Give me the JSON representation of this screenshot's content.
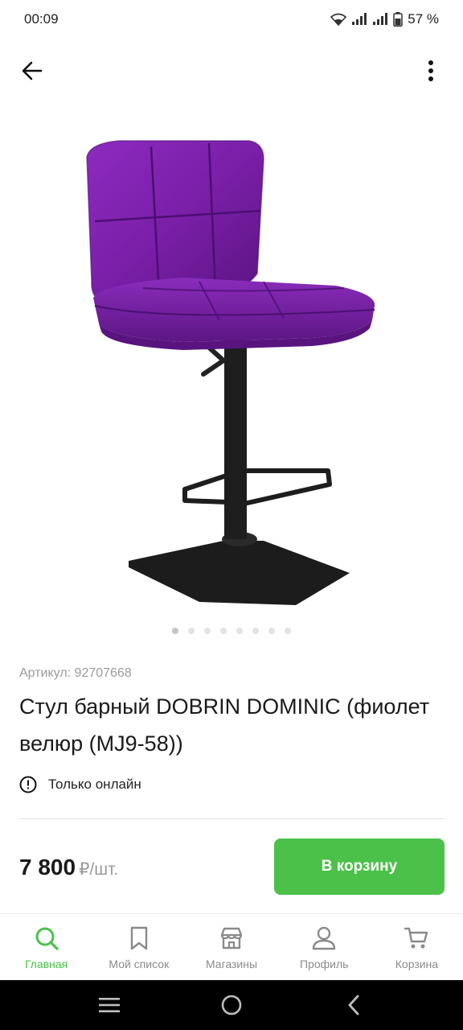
{
  "status_bar": {
    "time": "00:09",
    "battery": "57 %"
  },
  "product": {
    "article": "Артикул: 92707668",
    "title": "Стул барный DOBRIN DOMINIC (фиолет велюр (MJ9-58))",
    "availability": "Только онлайн",
    "price": "7 800",
    "unit": "₽/шт.",
    "add_to_cart_label": "В корзину",
    "image_count": 8,
    "active_image_index": 0
  },
  "bottom_nav": {
    "items": [
      {
        "label": "Главная",
        "icon": "search-icon",
        "active": true
      },
      {
        "label": "Мой список",
        "icon": "bookmark-icon",
        "active": false
      },
      {
        "label": "Магазины",
        "icon": "store-icon",
        "active": false
      },
      {
        "label": "Профиль",
        "icon": "profile-icon",
        "active": false
      },
      {
        "label": "Корзина",
        "icon": "cart-icon",
        "active": false
      }
    ]
  },
  "colors": {
    "accent": "#4cc14a",
    "chair_fabric": "#7a1fa8"
  }
}
